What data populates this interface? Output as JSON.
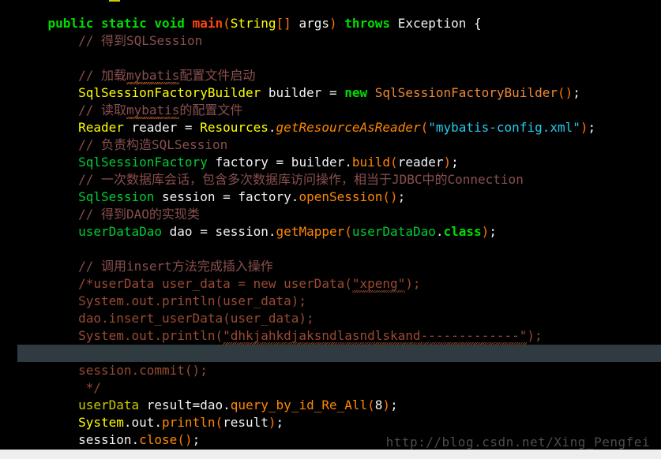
{
  "editor": {
    "language": "Java",
    "theme_background": "#000000",
    "current_line_highlight": "#2f3b40",
    "watermark": "http://blog.csdn.net/Xing_Pengfei",
    "colors": {
      "keyword": "#00dd00",
      "method_name": "#ff4411",
      "type_yellow": "#ffff00",
      "type_green": "#00cc33",
      "string": "#22ccee",
      "method_call": "#ff8800",
      "comment": "#8a4f4f",
      "block_comment": "#9a4a33",
      "punctuation": "#ff7700",
      "plain_text": "#e8e8e8",
      "constructor": "#ee8833",
      "watermark_text": "#4c4c4c"
    },
    "lines": [
      {
        "id": "line-0-partial",
        "highlighted": false,
        "tokens": []
      },
      {
        "id": "line-method-signature",
        "highlighted": false,
        "tokens": [
          {
            "text": "    ",
            "style": "t-plain"
          },
          {
            "text": "public",
            "style": "t-kw"
          },
          {
            "text": " ",
            "style": "t-plain"
          },
          {
            "text": "static",
            "style": "t-kw"
          },
          {
            "text": " ",
            "style": "t-plain"
          },
          {
            "text": "void",
            "style": "t-kw"
          },
          {
            "text": " ",
            "style": "t-plain"
          },
          {
            "text": "main",
            "style": "t-fn"
          },
          {
            "text": "(",
            "style": "t-punct"
          },
          {
            "text": "String",
            "style": "t-type-y"
          },
          {
            "text": "[]",
            "style": "t-punct"
          },
          {
            "text": " args",
            "style": "t-white"
          },
          {
            "text": ")",
            "style": "t-punct"
          },
          {
            "text": " ",
            "style": "t-plain"
          },
          {
            "text": "throws",
            "style": "t-kw"
          },
          {
            "text": " Exception ",
            "style": "t-white"
          },
          {
            "text": "{",
            "style": "t-white"
          }
        ]
      },
      {
        "id": "line-comment-get-sqlsession",
        "highlighted": false,
        "tokens": [
          {
            "text": "        // 得到SQLSession",
            "style": "t-cmt"
          }
        ]
      },
      {
        "id": "line-blank-1",
        "highlighted": false,
        "tokens": []
      },
      {
        "id": "line-comment-load-mybatis",
        "highlighted": false,
        "tokens": [
          {
            "text": "        // 加载",
            "style": "t-cmt"
          },
          {
            "text": "mybatis",
            "style": "t-cmt",
            "squiggle": true
          },
          {
            "text": "配置文件启动",
            "style": "t-cmt"
          }
        ]
      },
      {
        "id": "line-builder-decl",
        "highlighted": false,
        "tokens": [
          {
            "text": "        ",
            "style": "t-plain"
          },
          {
            "text": "SqlSessionFactoryBuilder",
            "style": "t-type-y"
          },
          {
            "text": " builder ",
            "style": "t-white"
          },
          {
            "text": "=",
            "style": "t-white"
          },
          {
            "text": " ",
            "style": "t-plain"
          },
          {
            "text": "new",
            "style": "t-kw"
          },
          {
            "text": " ",
            "style": "t-plain"
          },
          {
            "text": "SqlSessionFactoryBuilder",
            "style": "t-ctor"
          },
          {
            "text": "()",
            "style": "t-punct"
          },
          {
            "text": ";",
            "style": "t-white"
          }
        ]
      },
      {
        "id": "line-comment-read-mybatis",
        "highlighted": false,
        "tokens": [
          {
            "text": "        // 读取",
            "style": "t-cmt"
          },
          {
            "text": "mybatis",
            "style": "t-cmt",
            "squiggle": true
          },
          {
            "text": "的配置文件",
            "style": "t-cmt"
          }
        ]
      },
      {
        "id": "line-reader-decl",
        "highlighted": false,
        "tokens": [
          {
            "text": "        ",
            "style": "t-plain"
          },
          {
            "text": "Reader",
            "style": "t-type-y"
          },
          {
            "text": " reader ",
            "style": "t-white"
          },
          {
            "text": "=",
            "style": "t-white"
          },
          {
            "text": " ",
            "style": "t-plain"
          },
          {
            "text": "Resources",
            "style": "t-type-y"
          },
          {
            "text": ".",
            "style": "t-white"
          },
          {
            "text": "getResourceAsReader",
            "style": "t-method-i"
          },
          {
            "text": "(",
            "style": "t-punct"
          },
          {
            "text": "\"mybatis-config.xml\"",
            "style": "t-str"
          },
          {
            "text": ")",
            "style": "t-punct"
          },
          {
            "text": ";",
            "style": "t-white"
          }
        ]
      },
      {
        "id": "line-comment-build-sqlsession",
        "highlighted": false,
        "tokens": [
          {
            "text": "        // 负责构造SQLSession",
            "style": "t-cmt"
          }
        ]
      },
      {
        "id": "line-factory-decl",
        "highlighted": false,
        "tokens": [
          {
            "text": "        ",
            "style": "t-plain"
          },
          {
            "text": "SqlSessionFactory",
            "style": "t-type-g"
          },
          {
            "text": " factory ",
            "style": "t-white"
          },
          {
            "text": "=",
            "style": "t-white"
          },
          {
            "text": " builder",
            "style": "t-white"
          },
          {
            "text": ".",
            "style": "t-white"
          },
          {
            "text": "build",
            "style": "t-method"
          },
          {
            "text": "(",
            "style": "t-punct"
          },
          {
            "text": "reader",
            "style": "t-white"
          },
          {
            "text": ")",
            "style": "t-punct"
          },
          {
            "text": ";",
            "style": "t-white"
          }
        ]
      },
      {
        "id": "line-comment-session-desc",
        "highlighted": false,
        "tokens": [
          {
            "text": "        // 一次数据库会话，包含多次数据库访问操作，相当于JDBC中的Connection",
            "style": "t-cmt"
          }
        ]
      },
      {
        "id": "line-session-decl",
        "highlighted": false,
        "tokens": [
          {
            "text": "        ",
            "style": "t-plain"
          },
          {
            "text": "SqlSession",
            "style": "t-type-g"
          },
          {
            "text": " session ",
            "style": "t-white"
          },
          {
            "text": "=",
            "style": "t-white"
          },
          {
            "text": " factory",
            "style": "t-white"
          },
          {
            "text": ".",
            "style": "t-white"
          },
          {
            "text": "openSession",
            "style": "t-method"
          },
          {
            "text": "()",
            "style": "t-punct"
          },
          {
            "text": ";",
            "style": "t-white"
          }
        ]
      },
      {
        "id": "line-comment-dao-impl",
        "highlighted": false,
        "tokens": [
          {
            "text": "        // 得到DAO的实现类",
            "style": "t-cmt"
          }
        ]
      },
      {
        "id": "line-dao-decl",
        "highlighted": false,
        "tokens": [
          {
            "text": "        ",
            "style": "t-plain"
          },
          {
            "text": "userDataDao",
            "style": "t-type-g"
          },
          {
            "text": " dao ",
            "style": "t-white"
          },
          {
            "text": "=",
            "style": "t-white"
          },
          {
            "text": " session",
            "style": "t-white"
          },
          {
            "text": ".",
            "style": "t-white"
          },
          {
            "text": "getMapper",
            "style": "t-method"
          },
          {
            "text": "(",
            "style": "t-punct"
          },
          {
            "text": "userDataDao",
            "style": "t-type-g"
          },
          {
            "text": ".",
            "style": "t-white"
          },
          {
            "text": "class",
            "style": "t-kw2"
          },
          {
            "text": ")",
            "style": "t-punct"
          },
          {
            "text": ";",
            "style": "t-white"
          }
        ]
      },
      {
        "id": "line-blank-2",
        "highlighted": false,
        "tokens": []
      },
      {
        "id": "line-comment-insert",
        "highlighted": false,
        "tokens": [
          {
            "text": "        // 调用insert方法完成插入操作",
            "style": "t-cmt"
          }
        ]
      },
      {
        "id": "line-blockcomment-userdata",
        "highlighted": false,
        "tokens": [
          {
            "text": "        /*userData user_data = new userData(",
            "style": "t-cmtblk"
          },
          {
            "text": "\"xpeng\"",
            "style": "t-cmtblk",
            "squiggle": "dim"
          },
          {
            "text": ");",
            "style": "t-cmtblk"
          }
        ]
      },
      {
        "id": "line-blockcomment-println1",
        "highlighted": false,
        "tokens": [
          {
            "text": "        System.out.println(user_data);",
            "style": "t-cmtblk"
          }
        ]
      },
      {
        "id": "line-blockcomment-insert-call",
        "highlighted": false,
        "tokens": [
          {
            "text": "        dao.insert_userData(user_data);",
            "style": "t-cmtblk"
          }
        ]
      },
      {
        "id": "line-blockcomment-println2",
        "highlighted": false,
        "tokens": [
          {
            "text": "        System.out.println(",
            "style": "t-cmtblk"
          },
          {
            "text": "\"dhkjahkdjaksndlasndlskand-------------\"",
            "style": "t-cmtblk",
            "squiggle": "dim"
          },
          {
            "text": ");",
            "style": "t-cmtblk"
          }
        ]
      },
      {
        "id": "line-current-empty",
        "highlighted": true,
        "tokens": []
      },
      {
        "id": "line-blockcomment-commit",
        "highlighted": false,
        "tokens": [
          {
            "text": "        session.commit();",
            "style": "t-cmtblk"
          }
        ]
      },
      {
        "id": "line-blockcomment-end",
        "highlighted": false,
        "tokens": [
          {
            "text": "         */",
            "style": "t-cmtblk"
          }
        ]
      },
      {
        "id": "line-query-result",
        "highlighted": false,
        "tokens": [
          {
            "text": "        ",
            "style": "t-plain"
          },
          {
            "text": "userData",
            "style": "t-type-ol"
          },
          {
            "text": " result",
            "style": "t-white"
          },
          {
            "text": "=",
            "style": "t-white"
          },
          {
            "text": "dao",
            "style": "t-white"
          },
          {
            "text": ".",
            "style": "t-white"
          },
          {
            "text": "query_by_id_Re_All",
            "style": "t-method"
          },
          {
            "text": "(",
            "style": "t-punct"
          },
          {
            "text": "8",
            "style": "t-white"
          },
          {
            "text": ")",
            "style": "t-punct"
          },
          {
            "text": ";",
            "style": "t-white"
          }
        ]
      },
      {
        "id": "line-println-result",
        "highlighted": false,
        "tokens": [
          {
            "text": "        ",
            "style": "t-plain"
          },
          {
            "text": "System",
            "style": "t-type-y"
          },
          {
            "text": ".out.",
            "style": "t-white"
          },
          {
            "text": "println",
            "style": "t-method"
          },
          {
            "text": "(",
            "style": "t-punct"
          },
          {
            "text": "result",
            "style": "t-white"
          },
          {
            "text": ")",
            "style": "t-punct"
          },
          {
            "text": ";",
            "style": "t-white"
          }
        ]
      },
      {
        "id": "line-session-close",
        "highlighted": false,
        "tokens": [
          {
            "text": "        session",
            "style": "t-white"
          },
          {
            "text": ".",
            "style": "t-white"
          },
          {
            "text": "close",
            "style": "t-method"
          },
          {
            "text": "()",
            "style": "t-punct"
          },
          {
            "text": ";",
            "style": "t-white"
          }
        ]
      }
    ]
  }
}
